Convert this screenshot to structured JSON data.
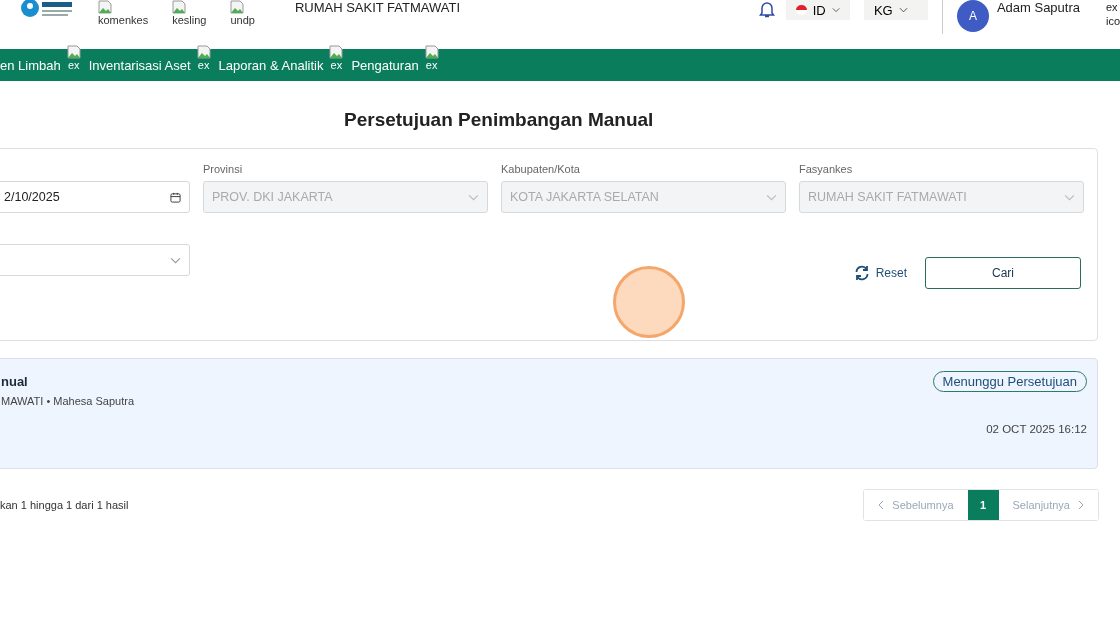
{
  "header": {
    "partner_logos": [
      {
        "label": "komenkes"
      },
      {
        "label": "kesling"
      },
      {
        "label": "undp"
      }
    ],
    "facility": "RUMAH SAKIT FATMAWATI",
    "language": "ID",
    "unit": "KG",
    "user": {
      "initial": "A",
      "name": "Adam Saputra"
    },
    "broken_image_text": [
      "ex",
      "ico"
    ]
  },
  "nav": [
    {
      "label": "en Limbah",
      "alt": "ex"
    },
    {
      "label": "Inventarisasi Aset",
      "alt": "ex"
    },
    {
      "label": "Laporan & Analitik",
      "alt": "ex"
    },
    {
      "label": "Pengaturan",
      "alt": "ex"
    }
  ],
  "page_title": "Persetujuan Penimbangan Manual",
  "filters": {
    "date": {
      "value": "2/10/2025"
    },
    "selects": [
      {
        "label": "Provinsi",
        "value": "PROV. DKI JAKARTA",
        "disabled": true
      },
      {
        "label": "Kabupaten/Kota",
        "value": "KOTA JAKARTA SELATAN",
        "disabled": true
      },
      {
        "label": "Fasyankes",
        "value": "RUMAH SAKIT FATMAWATI",
        "disabled": true
      }
    ],
    "reset": "Reset",
    "search": "Cari"
  },
  "results": [
    {
      "title": "nual",
      "meta": "MAWATI • Mahesa Saputra",
      "status": "Menunggu Persetujuan",
      "datetime": "02 OCT 2025 16:12"
    }
  ],
  "footer": {
    "summary": "kan 1 hingga 1 dari 1 hasil",
    "prev": "Sebelumnya",
    "next": "Selanjutnya",
    "pages": [
      {
        "label": "1",
        "selected": true
      }
    ]
  }
}
